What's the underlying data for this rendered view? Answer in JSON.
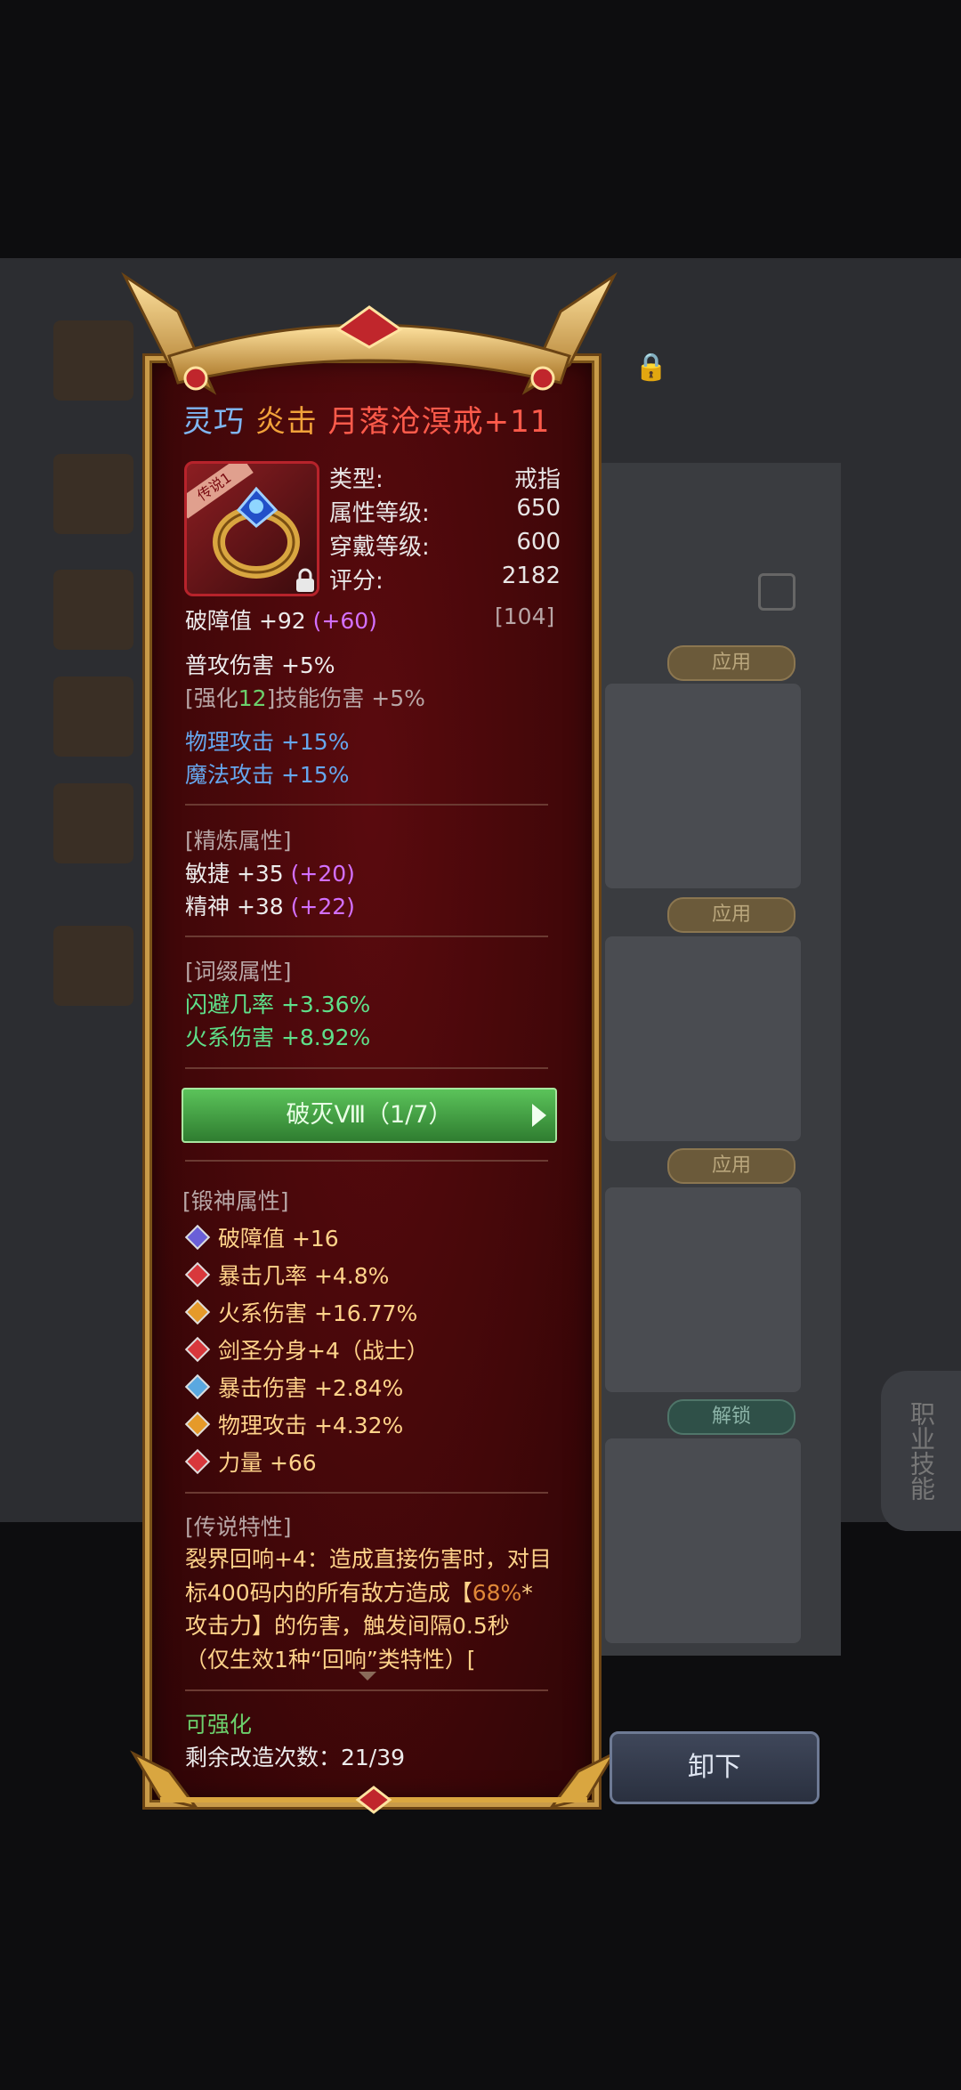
{
  "item": {
    "title_prefix_1": "灵巧",
    "title_prefix_2": "炎击",
    "title_name": "月落沧溟戒+11",
    "rarity_label": "传说1",
    "icon": "ring-icon"
  },
  "info": [
    {
      "label": "类型:",
      "value": "戒指"
    },
    {
      "label": "属性等级:",
      "value": "650"
    },
    {
      "label": "穿戴等级:",
      "value": "600"
    },
    {
      "label": "评分:",
      "value": "2182"
    }
  ],
  "base": {
    "break_label": "破障值 +92",
    "break_bonus": "(+60)",
    "break_cap": "[104]",
    "normal_attack": "普攻伤害 +5%",
    "enhance_open": "[强化",
    "enhance_level": "12",
    "enhance_close": "]技能伤害 +5%",
    "physical": "物理攻击 +15%",
    "magic": "魔法攻击 +15%"
  },
  "refine": {
    "header": "[精炼属性]",
    "agility": "敏捷 +35",
    "agility_bonus": "(+20)",
    "spirit": "精神 +38",
    "spirit_bonus": "(+22)"
  },
  "affix": {
    "header": "[词缀属性]",
    "dodge": "闪避几率 +3.36%",
    "fire": "火系伤害 +8.92%"
  },
  "set_bar": "破灭Ⅷ（1/7）",
  "forge": {
    "header": "[锻神属性]",
    "lines": [
      {
        "text": "破障值 +16",
        "gem_color": "#6a5fd8"
      },
      {
        "text": "暴击几率 +4.8%",
        "gem_color": "#d8383c"
      },
      {
        "text": "火系伤害 +16.77%",
        "gem_color": "#e59a2a"
      },
      {
        "text": "剑圣分身+4（战士）",
        "gem_color": "#d8383c"
      },
      {
        "text": "暴击伤害 +2.84%",
        "gem_color": "#5aa8e0"
      },
      {
        "text": "物理攻击 +4.32%",
        "gem_color": "#e59a2a"
      },
      {
        "text": "力量 +66",
        "gem_color": "#d8383c"
      }
    ]
  },
  "legend": {
    "header": "[传说特性]",
    "text_a": "裂界回响+4：造成直接伤害时，对目标400码内的所有敌方造成【",
    "text_b": "68%",
    "text_c": "*攻击力】的伤害，触发间隔0.5秒（仅生效1种“回响”类特性）["
  },
  "footer": {
    "enhanceable": "可强化",
    "remaining": "剩余改造次数：21/39"
  },
  "unequip_label": "卸下",
  "background": {
    "apply_labels": [
      "应用",
      "应用",
      "应用"
    ],
    "unlock_label": "解锁",
    "side_label": "职业技能"
  }
}
